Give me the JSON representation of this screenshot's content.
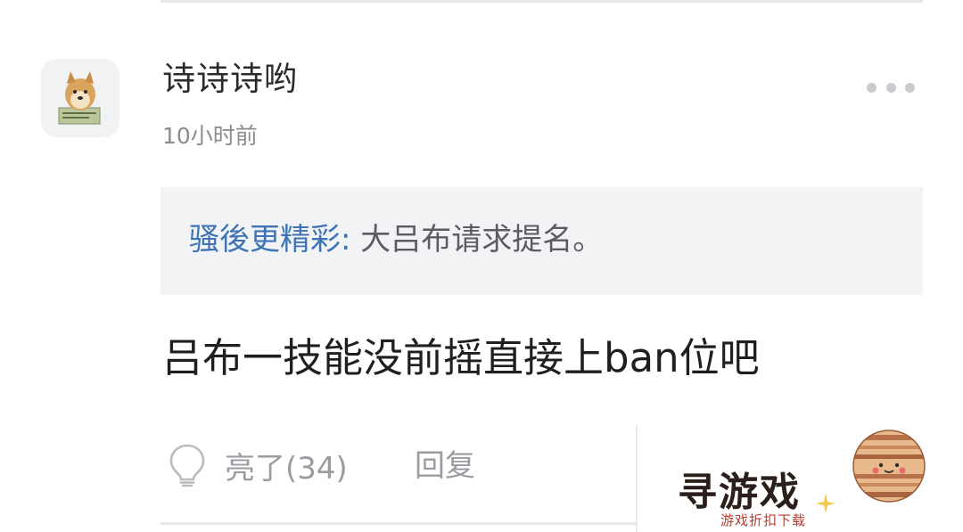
{
  "comment": {
    "author": "诗诗诗哟",
    "time": "10小时前",
    "more_icon": "more-horizontal-icon",
    "quote": {
      "author": "骚後更精彩",
      "separator": ": ",
      "text": "大吕布请求提名。"
    },
    "body": "吕布一技能没前摇直接上ban位吧",
    "actions": {
      "like_icon": "lightbulb-icon",
      "like_label": "亮了(34)",
      "reply_label": "回复"
    }
  },
  "watermark": {
    "title": "寻游戏",
    "subtitle": "游戏折扣下载"
  },
  "colors": {
    "quote_author": "#3e74b5",
    "quote_background": "#f2f3f5",
    "muted_text": "#9a9ca1",
    "primary_text": "#1f1f1f"
  }
}
